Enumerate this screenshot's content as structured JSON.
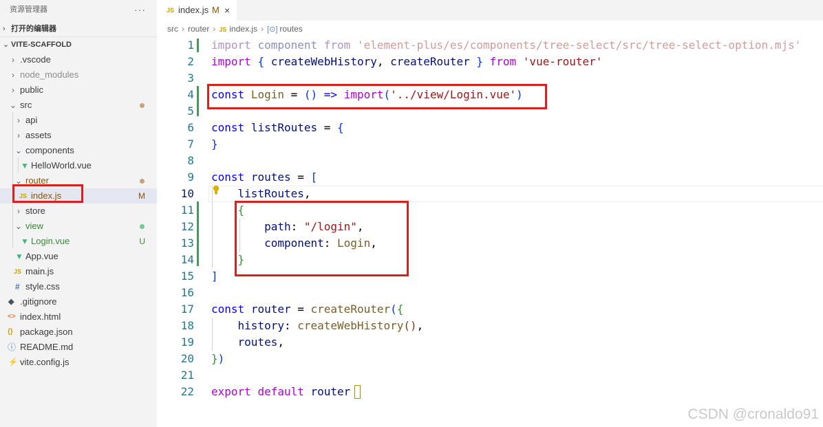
{
  "explorer": {
    "title": "资源管理器",
    "more": "···",
    "open_editors": "打开的编辑器",
    "project": "VITE-SCAFFOLD",
    "tree": [
      {
        "label": "📄.vscode",
        "text": ".vscode"
      },
      {
        "text": "node_modules"
      },
      {
        "text": "public"
      },
      {
        "text": "src"
      },
      {
        "text": "api"
      },
      {
        "text": "assets"
      },
      {
        "text": "components"
      },
      {
        "text": "HelloWorld.vue"
      },
      {
        "text": "router"
      },
      {
        "text": "index.js",
        "badge": "M"
      },
      {
        "text": "store"
      },
      {
        "text": "view"
      },
      {
        "text": "Login.vue",
        "badge": "U"
      },
      {
        "text": "App.vue"
      },
      {
        "text": "main.js"
      },
      {
        "text": "style.css"
      },
      {
        "text": ".gitignore"
      },
      {
        "text": "index.html"
      },
      {
        "text": "package.json"
      },
      {
        "text": "README.md"
      },
      {
        "text": "vite.config.js"
      }
    ],
    "icons": {
      "js": "JS",
      "css": "#",
      "html": "<>",
      "json": "{}",
      "info": "ⓘ",
      "vite": "⚡"
    }
  },
  "tab": {
    "icon": "JS",
    "name": "index.js",
    "modified": "M",
    "close": "×"
  },
  "breadcrumb": {
    "parts": [
      "src",
      "router",
      "index.js",
      "routes"
    ]
  },
  "line_numbers": [
    "1",
    "2",
    "3",
    "4",
    "5",
    "6",
    "7",
    "8",
    "9",
    "10",
    "11",
    "12",
    "13",
    "14",
    "15",
    "16",
    "17",
    "18",
    "19",
    "20",
    "21",
    "22"
  ],
  "colors": {
    "accent_red": "#d9201e",
    "modified": "#895503",
    "untracked": "#388a34",
    "gutter_added": "#48985d"
  },
  "watermark": "CSDN @cronaldo91"
}
